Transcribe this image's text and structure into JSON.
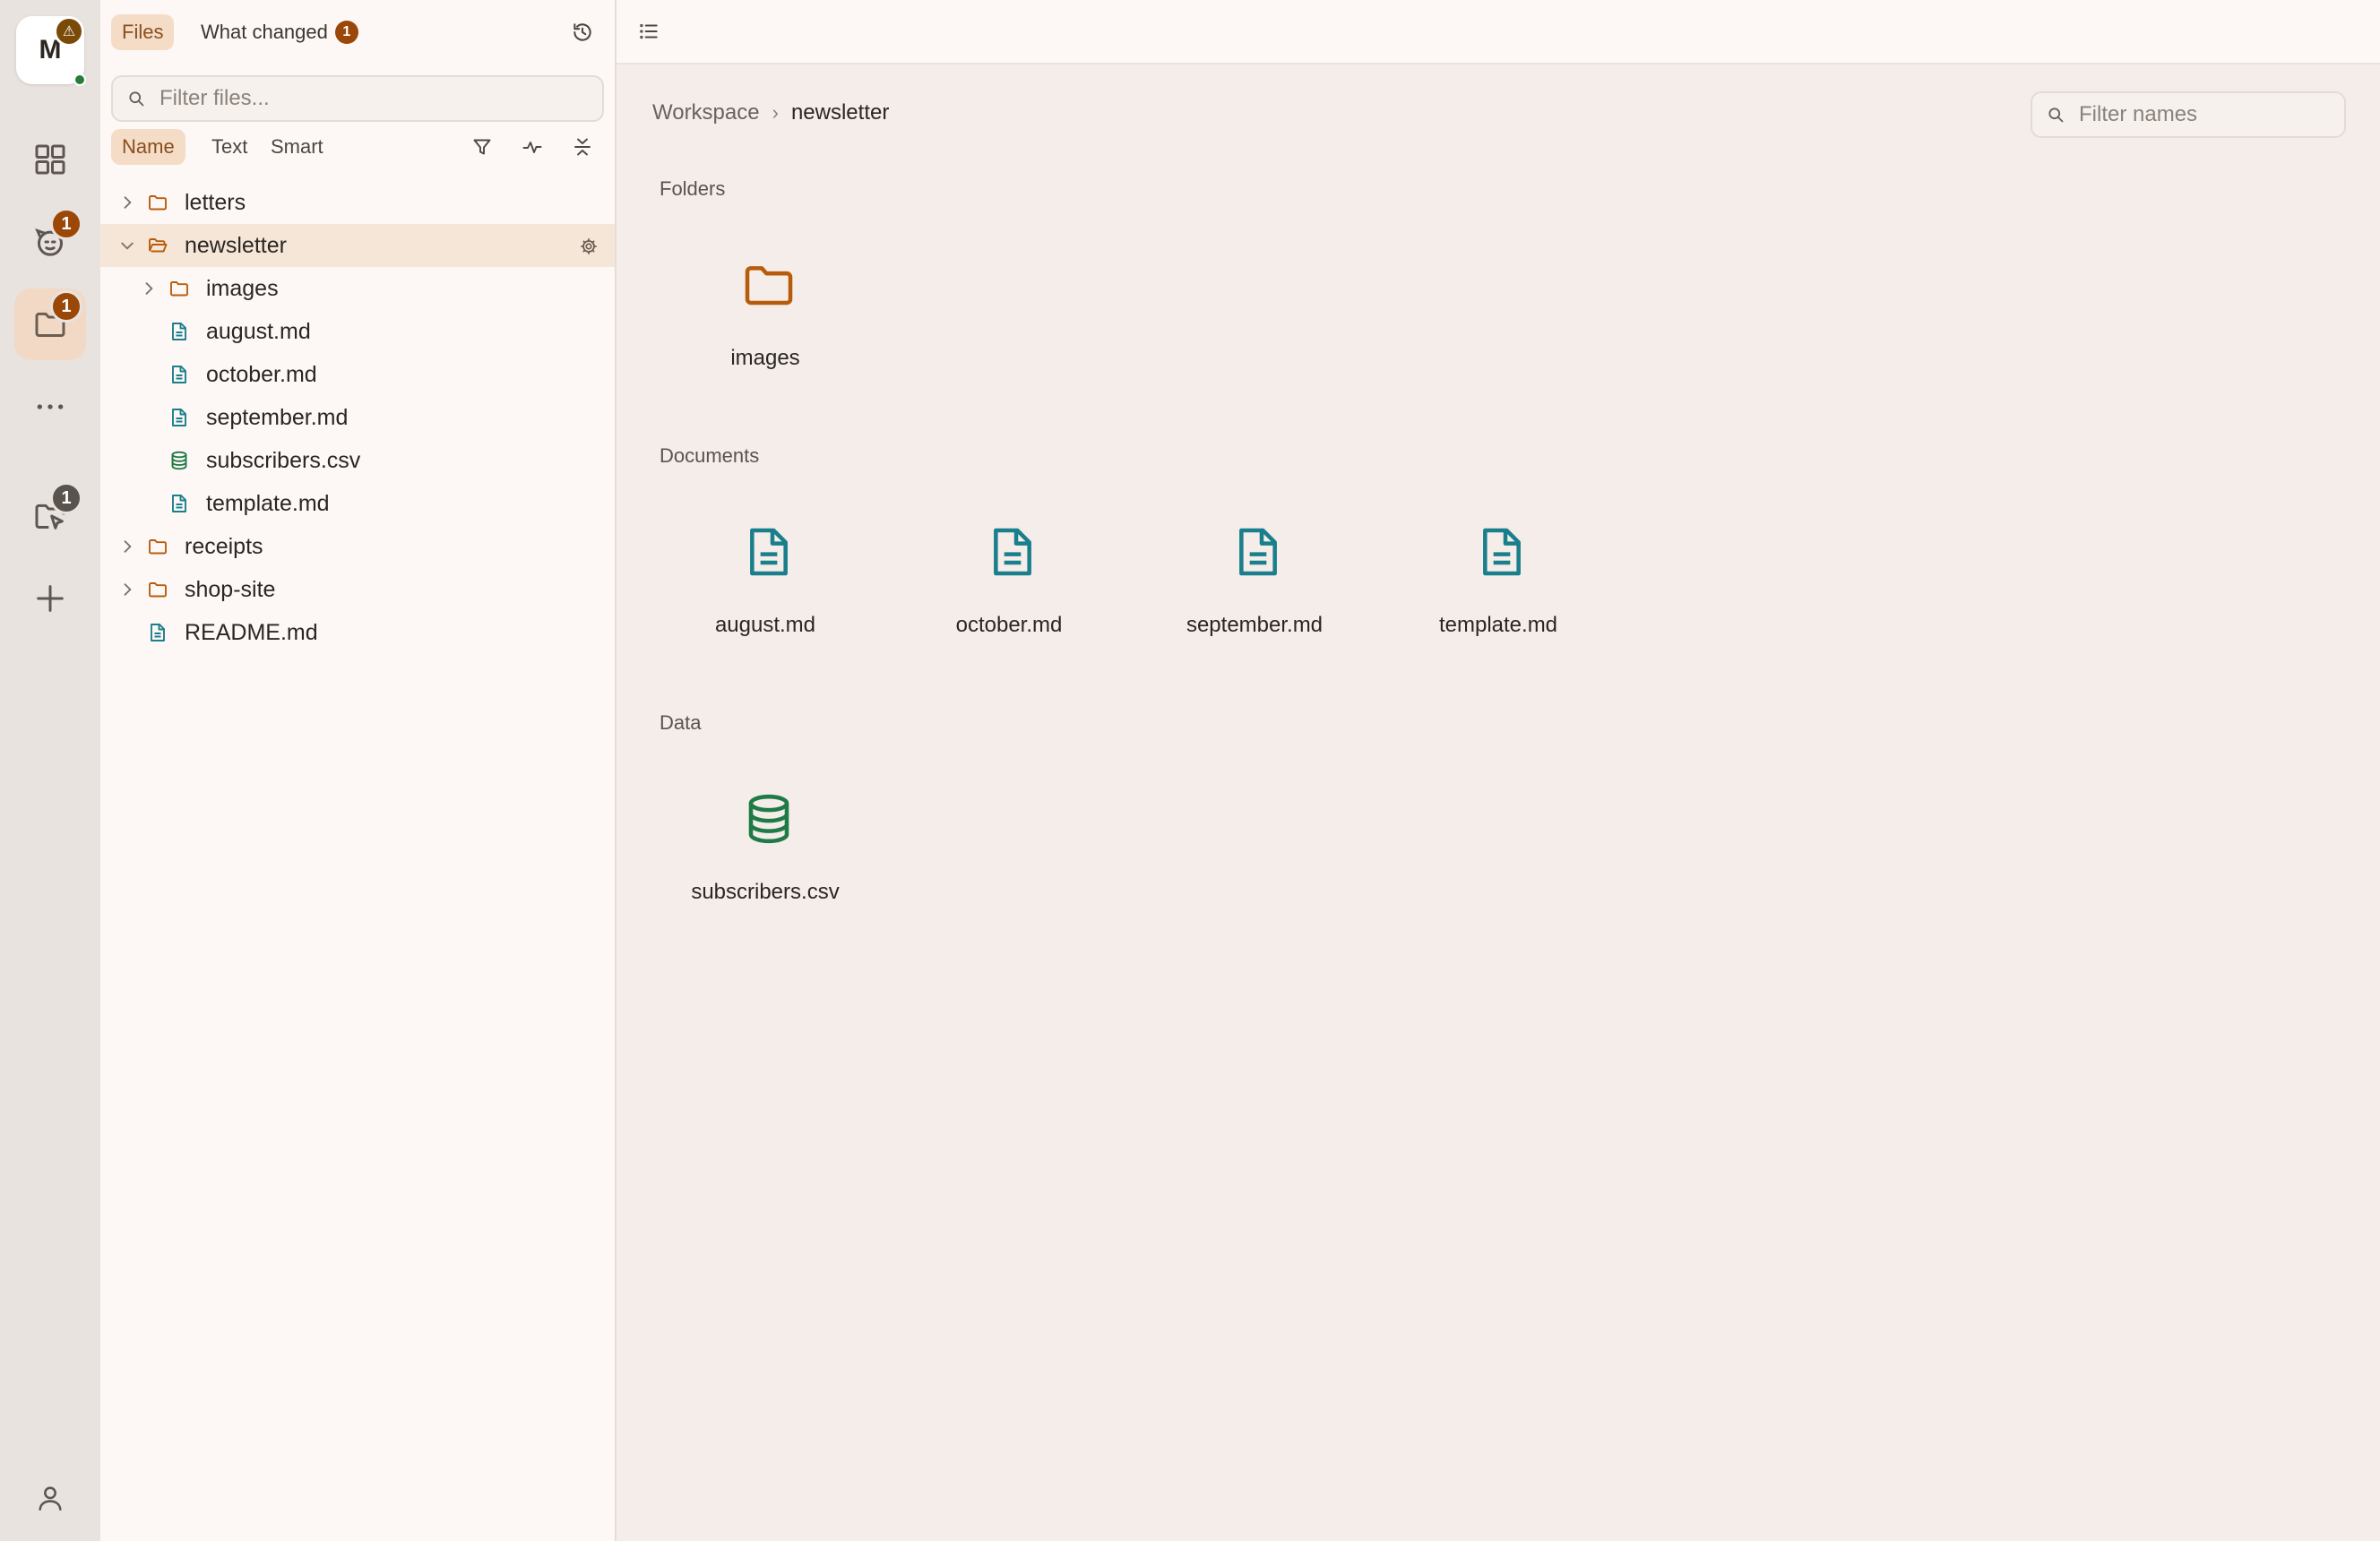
{
  "colors": {
    "accent": "#f5dcc7",
    "accent_text": "#8a4e1c",
    "badge": "#9a4708",
    "folder": "#b85c0c",
    "document": "#1a7f8c",
    "data": "#1f7a45"
  },
  "rail": {
    "workspace_initial": "M",
    "items": [
      {
        "name": "dashboard-icon",
        "badge": ""
      },
      {
        "name": "assistant-icon",
        "badge": "1"
      },
      {
        "name": "files-icon",
        "badge": "1"
      },
      {
        "name": "more-icon",
        "badge": ""
      },
      {
        "name": "review-icon",
        "badge": "1"
      },
      {
        "name": "add-icon",
        "badge": ""
      },
      {
        "name": "account-icon",
        "badge": ""
      }
    ]
  },
  "sidebar": {
    "tabs": [
      {
        "label": "Files",
        "count": ""
      },
      {
        "label": "What changed",
        "count": "1"
      }
    ],
    "search_placeholder": "Filter files...",
    "sort_options": [
      "Name",
      "Text",
      "Smart"
    ],
    "tree": [
      {
        "label": "letters",
        "type": "folder",
        "depth": 0,
        "expanded": false
      },
      {
        "label": "newsletter",
        "type": "folder",
        "depth": 0,
        "expanded": true,
        "selected": true
      },
      {
        "label": "images",
        "type": "folder",
        "depth": 1,
        "expanded": false
      },
      {
        "label": "august.md",
        "type": "document",
        "depth": 1
      },
      {
        "label": "october.md",
        "type": "document",
        "depth": 1
      },
      {
        "label": "september.md",
        "type": "document",
        "depth": 1
      },
      {
        "label": "subscribers.csv",
        "type": "data",
        "depth": 1
      },
      {
        "label": "template.md",
        "type": "document",
        "depth": 1
      },
      {
        "label": "receipts",
        "type": "folder",
        "depth": 0,
        "expanded": false
      },
      {
        "label": "shop-site",
        "type": "folder",
        "depth": 0,
        "expanded": false
      },
      {
        "label": "README.md",
        "type": "document",
        "depth": 0
      }
    ]
  },
  "main": {
    "breadcrumb": {
      "root": "Workspace",
      "separator": "›",
      "current": "newsletter"
    },
    "search_placeholder": "Filter names",
    "sections": [
      {
        "label": "Folders",
        "items": [
          {
            "label": "images",
            "type": "folder"
          }
        ]
      },
      {
        "label": "Documents",
        "items": [
          {
            "label": "august.md",
            "type": "document"
          },
          {
            "label": "october.md",
            "type": "document"
          },
          {
            "label": "september.md",
            "type": "document"
          },
          {
            "label": "template.md",
            "type": "document"
          }
        ]
      },
      {
        "label": "Data",
        "items": [
          {
            "label": "subscribers.csv",
            "type": "data"
          }
        ]
      }
    ]
  }
}
